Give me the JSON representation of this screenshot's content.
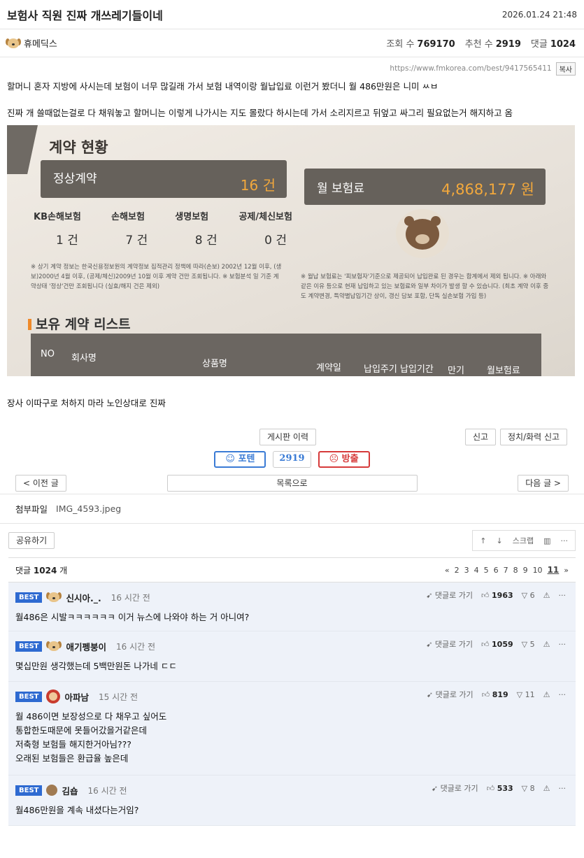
{
  "post": {
    "title": "보험사 직원 진짜 개쓰레기들이네",
    "date": "2026.01.24 21:48",
    "author": "휴메딕스",
    "views_label": "조회 수",
    "views": "769170",
    "recommend_label": "추천 수",
    "recommend": "2919",
    "comments_label": "댓글",
    "comments": "1024",
    "url": "https://www.fmkorea.com/best/9417565411",
    "copy_label": "복사",
    "paragraph1": "할머니 혼자 지방에 사시는데 보험이 너무 많길래 가서 보험 내역이랑 월납입료 이런거 봤더니 월 486만원은 니미 ㅆㅂ",
    "paragraph2": "진짜 개 쓸때없는걸로 다 채워놓고 할머니는 이렇게 나가시는 지도 몰랐다 하시는데 가서 소리지르고 뒤엎고 싸그리 필요없는거 해지하고 옴",
    "caption": "장사 이따구로 처하지 마라 노인상대로 진짜"
  },
  "photo": {
    "heading": "계약 현황",
    "normal_label": "정상계약",
    "normal_value": "16 건",
    "premium_label": "월 보험료",
    "premium_value": "4,868,177 원",
    "categories": [
      "KB손해보험",
      "손해보험",
      "생명보험",
      "공제/체신보험"
    ],
    "counts": [
      "1 건",
      "7 건",
      "8 건",
      "0 건"
    ],
    "note_left": "※ 상기 계약 정보는 한국신용정보원의 계약정보 집적관리 정책에 따라(손보) 2002년 12월 이후, (생보)2000년 4월 이후, (공제/체신)2009년 10월 이후 계약 건만 조회됩니다. ※ 보험분석 일 기준 계약상태 '정상'건만 조회됩니다 (실효/해지 건은 제외)",
    "note_right": "※ 월납 보험료는 '피보험자'기준으로 제공되어 납입완료 된 경우는 합계에서 제외 됩니다. ※ 아래와 같은 이유 등으로 현재 납입하고 있는 보험료와 일부 차이가 발생 할 수 있습니다. (최초 계약 이후 중도 계약변경, 특약별납입기간 상이, 갱신 담보 포함, 단독 실손보험 가입 등)",
    "list_heading": "보유 계약 리스트",
    "table_headers": [
      "NO",
      "회사명",
      "상품명",
      "계약일",
      "납입주기",
      "납입기간",
      "만기",
      "월보험료"
    ]
  },
  "actions": {
    "history": "게시판 이력",
    "report": "신고",
    "report_political": "정치/화력 신고",
    "vote_up": "포텐",
    "vote_count": "2919",
    "vote_down": "방출",
    "prev": "< 이전 글",
    "list": "목록으로",
    "next": "다음 글 >",
    "attach_label": "첨부파일",
    "attach_file": "IMG_4593.jpeg",
    "share": "공유하기",
    "scrap": "스크랩"
  },
  "comment_header": {
    "label": "댓글",
    "count": "1024",
    "unit": "개",
    "pages": [
      "«",
      "2",
      "3",
      "4",
      "5",
      "6",
      "7",
      "8",
      "9",
      "10"
    ],
    "current_page": "11",
    "next": "»"
  },
  "comments": [
    {
      "badge": "BEST",
      "name": "신시아._.",
      "time": "16 시간 전",
      "goto": "댓글로 가기",
      "likes": "1963",
      "dislikes": "6",
      "text": "월486은 시발ㅋㅋㅋㅋㅋㅋ 이거 뉴스에 나와야 하는 거 아니여?"
    },
    {
      "badge": "BEST",
      "name": "애기펭붕이",
      "time": "16 시간 전",
      "goto": "댓글로 가기",
      "likes": "1059",
      "dislikes": "5",
      "text": "몇십만원 생각했는데 5백만원돈 나가네 ㄷㄷ"
    },
    {
      "badge": "BEST",
      "name": "아파남",
      "time": "15 시간 전",
      "goto": "댓글로 가기",
      "likes": "819",
      "dislikes": "11",
      "text": "월 486이면 보장성으로 다 채우고 싶어도\n통합한도때문에 못들어갔을거같은데\n저축형 보험들 해지한거아님???\n오래된 보험들은 환급율 높은데"
    },
    {
      "badge": "BEST",
      "name": "김숍",
      "time": "16 시간 전",
      "goto": "댓글로 가기",
      "likes": "533",
      "dislikes": "8",
      "text": "월486만원을 계속 내셨다는거임?"
    }
  ]
}
